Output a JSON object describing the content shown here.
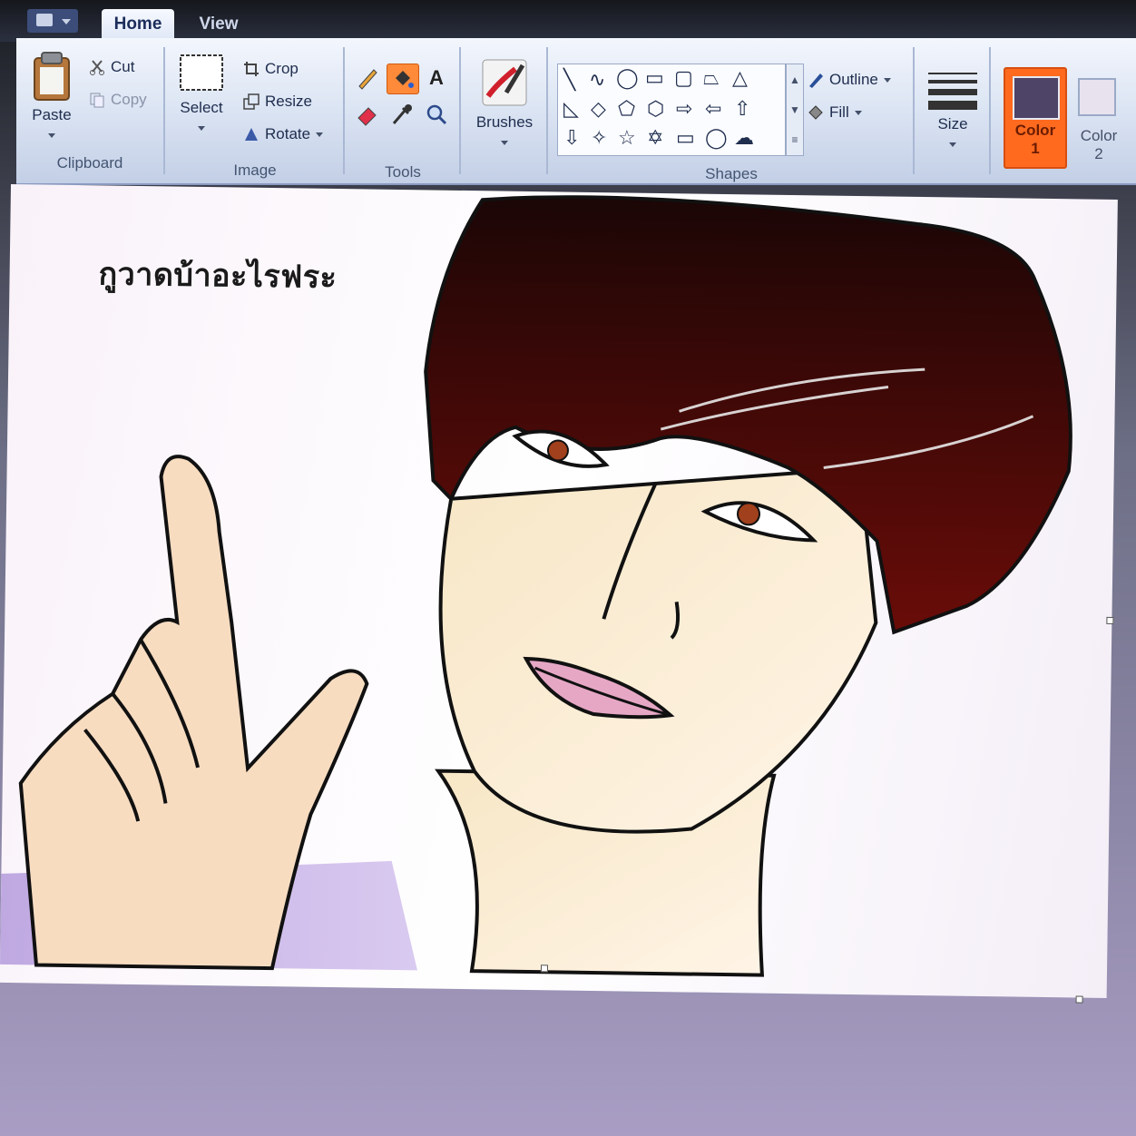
{
  "tabs": {
    "home": "Home",
    "view": "View"
  },
  "clipboard": {
    "paste": "Paste",
    "cut": "Cut",
    "copy": "Copy",
    "group": "Clipboard"
  },
  "image": {
    "select": "Select",
    "crop": "Crop",
    "resize": "Resize",
    "rotate": "Rotate",
    "group": "Image"
  },
  "tools": {
    "group": "Tools",
    "text_tool": "A"
  },
  "brushes": {
    "label": "Brushes"
  },
  "shapes": {
    "outline": "Outline",
    "fill": "Fill",
    "group": "Shapes"
  },
  "size": {
    "label": "Size"
  },
  "colors": {
    "color1_label": "Color",
    "color1_num": "1",
    "color2_label": "Color",
    "color2_num": "2",
    "color1_value": "#4d4467",
    "color2_value": "#e8e2ee",
    "active_accent": "#ff6a1f"
  },
  "canvas": {
    "caption": "กูวาดบ้าอะไรฟระ"
  },
  "icons": [
    "app-menu-icon",
    "paste-icon",
    "cut-icon",
    "copy-icon",
    "select-icon",
    "crop-icon",
    "resize-icon",
    "rotate-icon",
    "pencil-icon",
    "fill-bucket-icon",
    "text-icon",
    "eraser-icon",
    "color-picker-icon",
    "magnifier-icon",
    "brush-icon",
    "outline-icon",
    "fill-icon"
  ]
}
